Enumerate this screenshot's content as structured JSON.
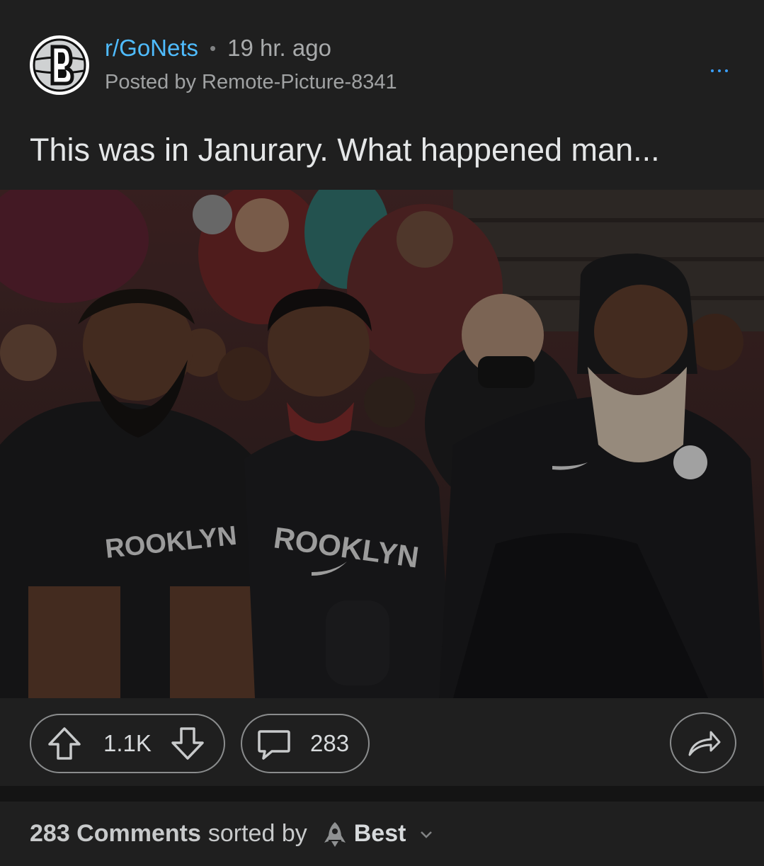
{
  "post": {
    "subreddit": "r/GoNets",
    "separator": "•",
    "time_ago": "19 hr. ago",
    "posted_by": "Posted by Remote-Picture-8341",
    "title": "This was in Janurary. What happened man...",
    "image_jersey_text": "ROOKLYN",
    "score": "1.1K",
    "comment_count": "283"
  },
  "comments_header": {
    "count_label": "283 Comments",
    "sorted_by_label": "sorted by",
    "sort_value": "Best"
  },
  "icons": {
    "more": "more-dots-icon",
    "upvote": "upvote-arrow-icon",
    "downvote": "downvote-arrow-icon",
    "comment": "comment-bubble-icon",
    "share": "share-arrow-icon",
    "sort": "rocket-icon",
    "chevron": "chevron-down-icon"
  },
  "colors": {
    "background": "#1f1f1f",
    "subreddit_link": "#4fbcff",
    "muted_text": "#a0a2a3",
    "outline": "#8a8c8d"
  }
}
